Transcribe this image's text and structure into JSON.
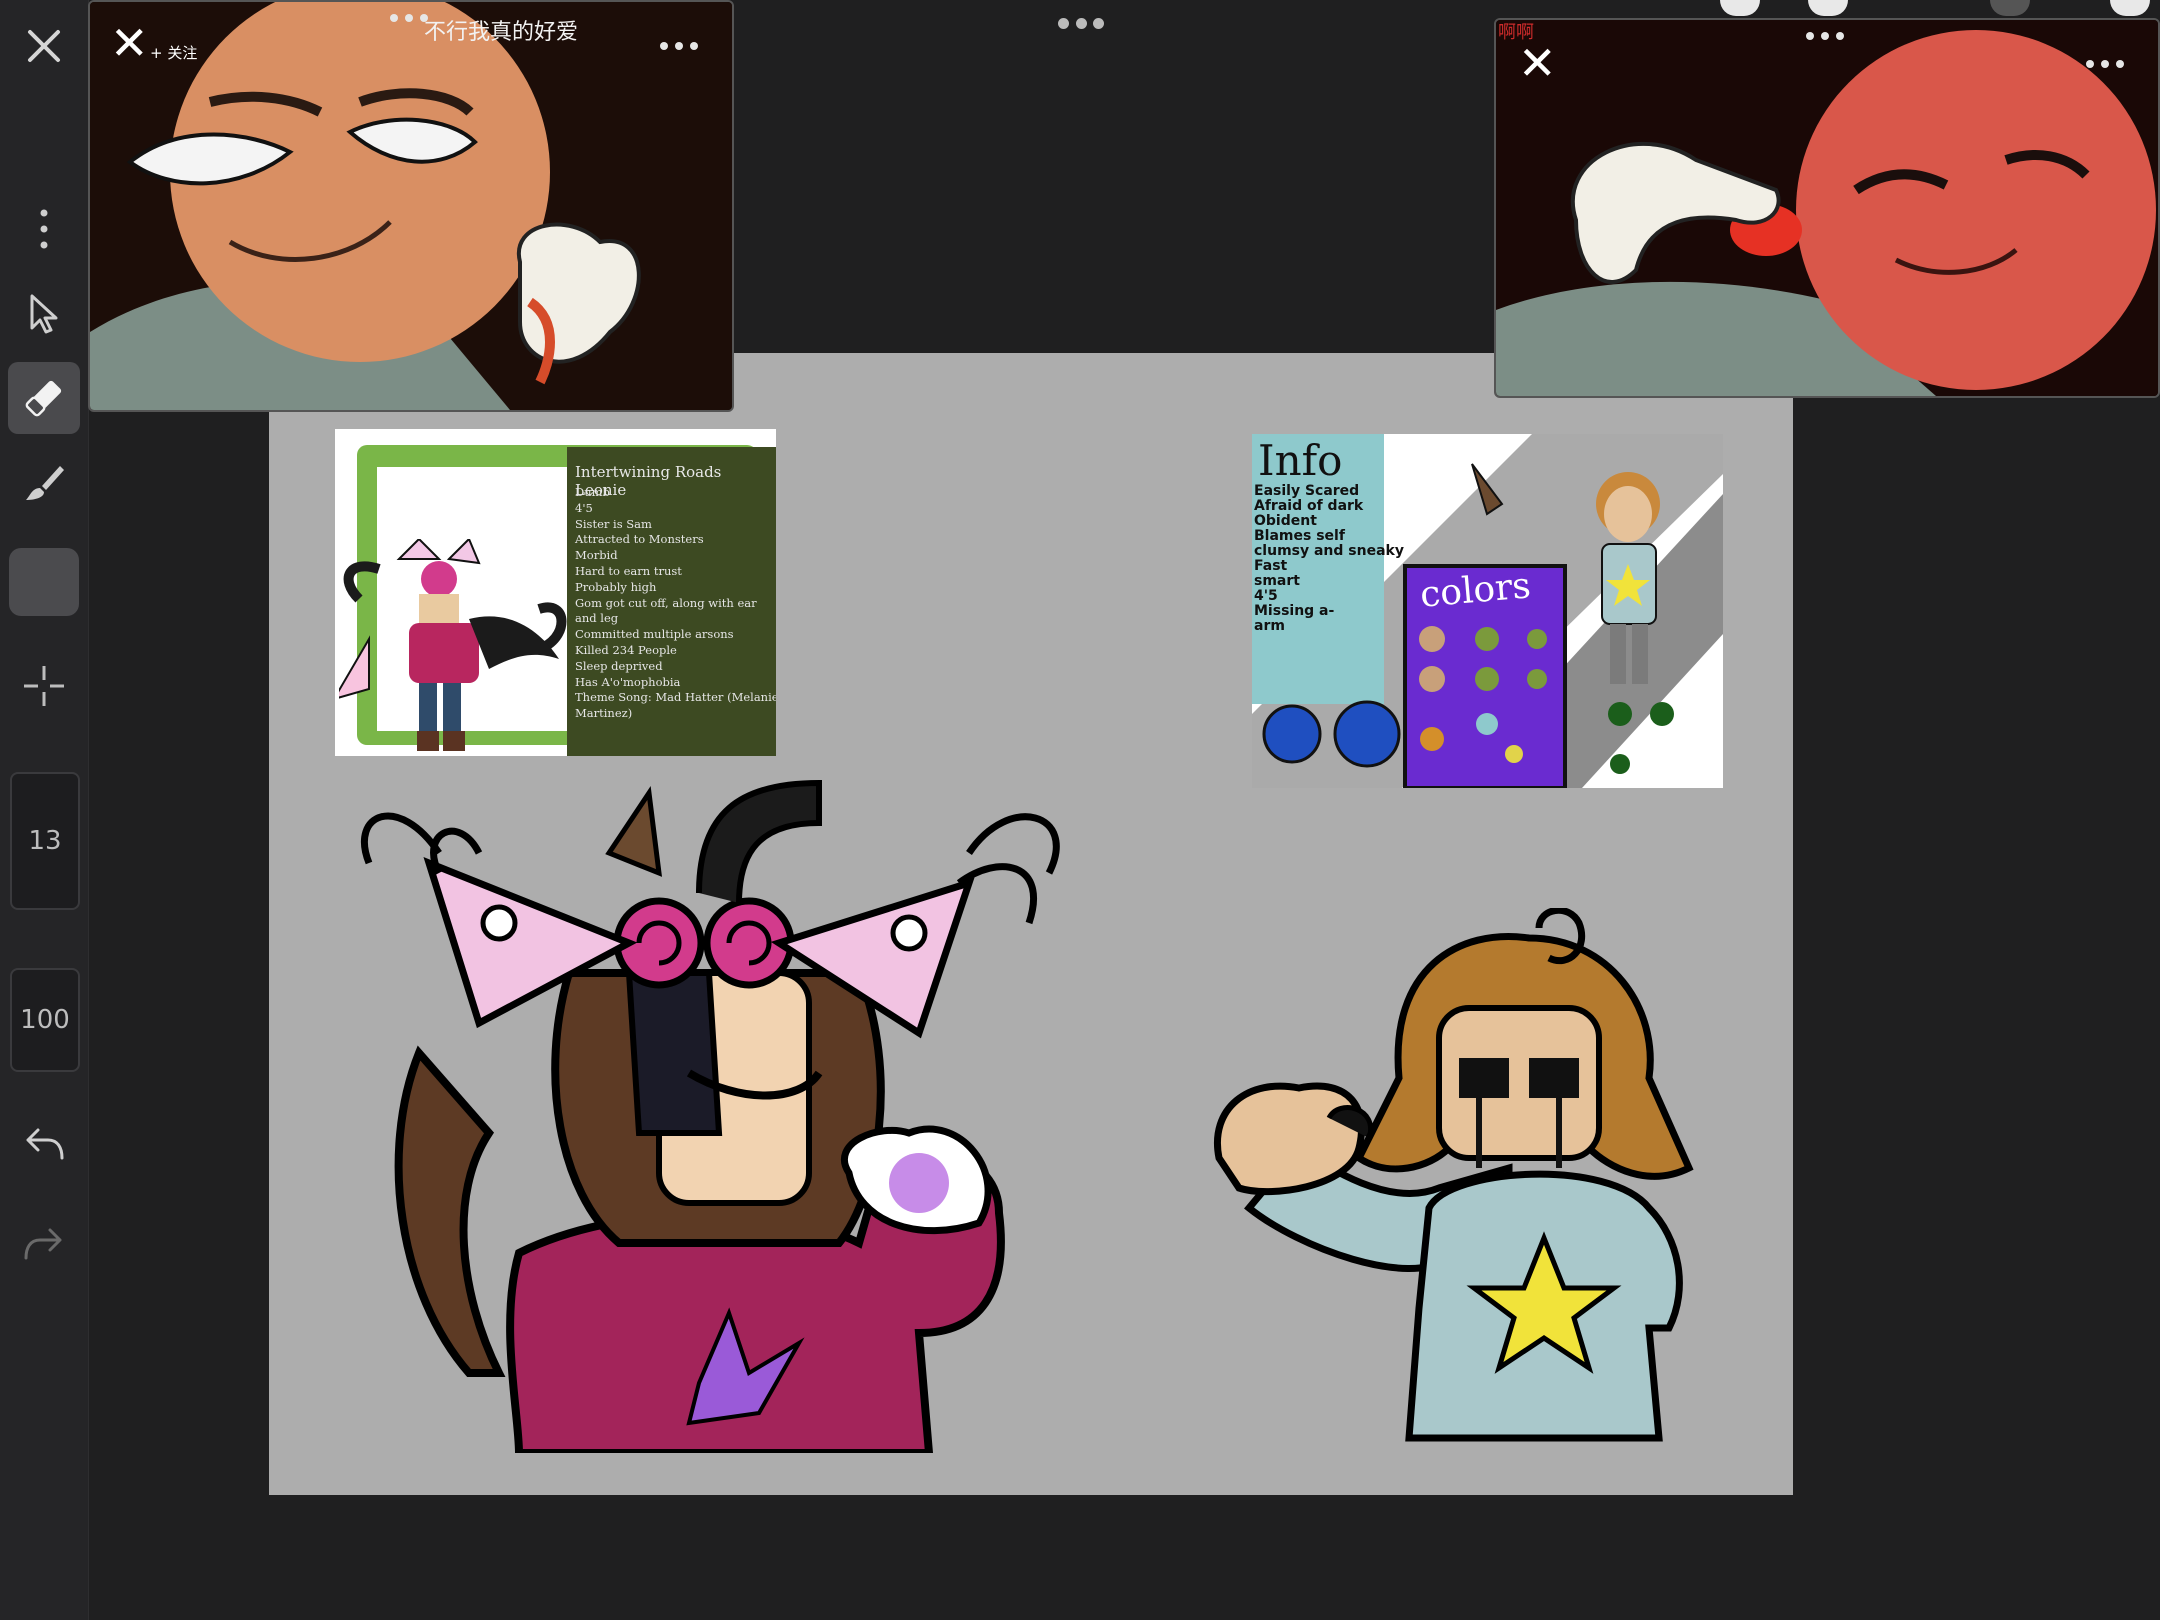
{
  "toolbar": {
    "brush_size": "13",
    "opacity": "100",
    "items": [
      {
        "name": "close-icon"
      },
      {
        "name": "more-icon"
      },
      {
        "name": "selection-arrow-icon"
      },
      {
        "name": "eraser-icon",
        "active": true
      },
      {
        "name": "brush-icon"
      },
      {
        "name": "color-swatch"
      },
      {
        "name": "transform-icon"
      },
      {
        "name": "undo-icon"
      },
      {
        "name": "redo-icon"
      }
    ],
    "swatch_color": "#4b4b4e"
  },
  "video_left": {
    "title": "不行我真的好爱",
    "follow_label": "+ 关注"
  },
  "video_right": {
    "overlay_text": "啊啊"
  },
  "ref_left": {
    "title": "Intertwining Roads Leonie",
    "lines": [
      "Dumb",
      "4'5",
      "Sister is Sam",
      "Attracted to Monsters",
      "Morbid",
      "Hard to earn trust",
      "Probably high",
      "Gom got cut off, along with ear",
      "and leg",
      "Committed multiple arsons",
      "Killed 234 People",
      "Sleep deprived",
      "Has A'o'mophobia",
      "Theme Song: Mad Hatter (Melanie",
      "Martinez)"
    ]
  },
  "ref_right": {
    "title": "Info",
    "colors_label": "colors",
    "lines": [
      "Easily Scared",
      "Afraid of dark",
      "Obident",
      "Blames self",
      "clumsy and sneaky",
      "Fast",
      "smart",
      "4'5",
      "Missing a-",
      "arm"
    ]
  },
  "colors": {
    "background": "#1f1f20",
    "canvas": "#adadad",
    "ref_left_panel": "#3d4a22",
    "ref_left_border": "#7ab648",
    "ref_right_bg": "#8ec9cc",
    "ref_right_colors_panel": "#6a2bd0",
    "sweater_maroon": "#a3245a",
    "sweater_blue": "#a9c8cb"
  }
}
